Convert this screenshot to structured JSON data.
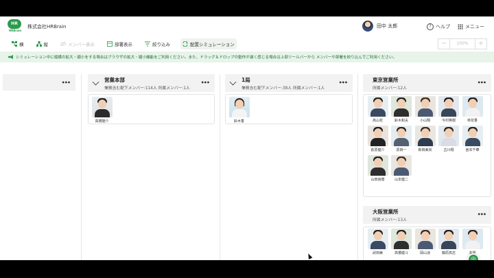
{
  "header": {
    "logo_text": "HR",
    "logo_sub": "HRBrain",
    "company": "株式会社HRBrain",
    "user_name": "田中 太郎",
    "help_label": "ヘルプ",
    "menu_label": "メニュー"
  },
  "toolbar": {
    "items": [
      {
        "label": "横",
        "icon": "tree-horizontal-icon"
      },
      {
        "label": "縦",
        "icon": "tree-vertical-icon"
      },
      {
        "label": "メンバー表示",
        "icon": "eye-off-icon"
      },
      {
        "label": "部署表示",
        "icon": "department-icon"
      },
      {
        "label": "絞り込み",
        "icon": "filter-icon"
      },
      {
        "label": "配置シミュレーション",
        "icon": "simulation-icon"
      }
    ],
    "zoom_minus": "−",
    "zoom_value": "100%",
    "zoom_plus": "+"
  },
  "banner": {
    "text": "シミュレーション中に縦横の拡大・縮小をする場合はブラウザの拡大・縮小機能をご利用ください。また、ドラッグ＆ドロップの動作が遅く感じる場合は上部ツールバーから メンバーや部署を絞り込んでご利用ください。"
  },
  "columns": [
    {
      "name": "",
      "sub": ""
    },
    {
      "name": "営業本部",
      "sub": "兼務含む配下メンバー:114人 所属メンバー:1人",
      "members": [
        {
          "name": "高橋隆介"
        }
      ]
    },
    {
      "name": "1局",
      "sub": "兼務含む配下メンバー:38人 所属メンバー:1人",
      "members": [
        {
          "name": "鈴木香"
        }
      ]
    }
  ],
  "offices": [
    {
      "name": "東京営業所",
      "sub": "所属メンバー:12人",
      "members": [
        {
          "name": "高山花"
        },
        {
          "name": "鈴木和夫"
        },
        {
          "name": "小山翔"
        },
        {
          "name": "今村英樹"
        },
        {
          "name": "林花香"
        },
        {
          "name": "荻原健介"
        },
        {
          "name": "原田一"
        },
        {
          "name": "新田美央"
        },
        {
          "name": "古川翔"
        },
        {
          "name": "宮本千華"
        },
        {
          "name": "山田良樹"
        },
        {
          "name": "山本健二"
        }
      ]
    },
    {
      "name": "大阪営業所",
      "sub": "所属メンバー:13人",
      "members": [
        {
          "name": "武田美"
        },
        {
          "name": "高橋健斗"
        },
        {
          "name": "岡山涼"
        },
        {
          "name": "藤原高志"
        },
        {
          "name": "本間"
        }
      ]
    }
  ]
}
